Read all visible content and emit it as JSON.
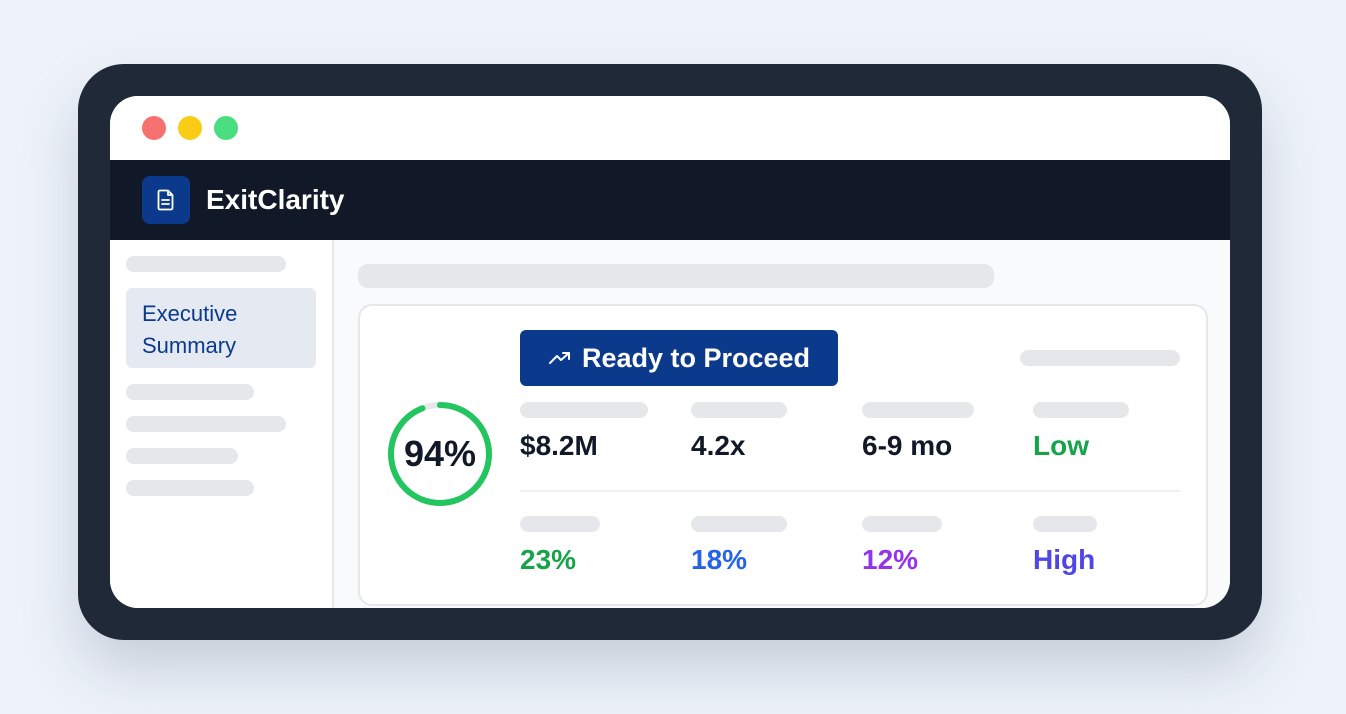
{
  "window": {
    "traffic_lights": [
      "close",
      "minimize",
      "maximize"
    ]
  },
  "app": {
    "name": "ExitClarity",
    "logo_icon": "document-icon"
  },
  "sidebar": {
    "active_item": "Executive Summary"
  },
  "summary": {
    "score": "94%",
    "score_fraction": 0.94,
    "status_button": "Ready to Proceed",
    "status_icon": "trending-up-icon",
    "metrics_row1": [
      "$8.2M",
      "4.2x",
      "6-9 mo",
      "Low"
    ],
    "metrics_row2": [
      "23%",
      "18%",
      "12%",
      "High"
    ]
  },
  "colors": {
    "brand": "#0b3a8c",
    "ring": "#22c55e",
    "green": "#16a34a",
    "blue": "#2563eb",
    "purple": "#9333ea",
    "indigo": "#4f46e5"
  }
}
